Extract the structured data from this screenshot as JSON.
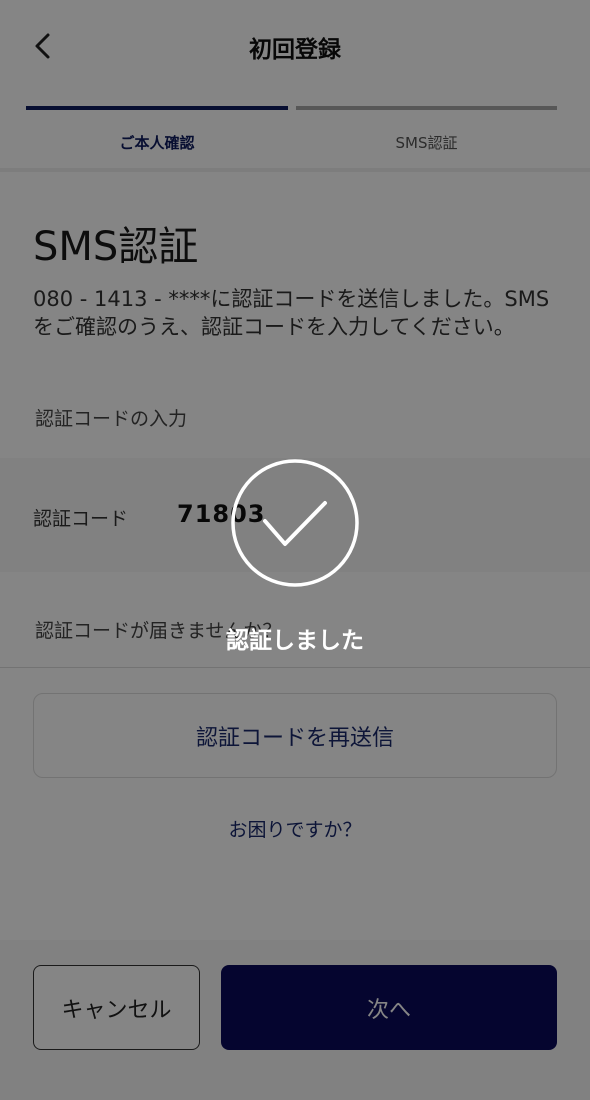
{
  "header": {
    "title": "初回登録"
  },
  "steps": [
    {
      "label": "ご本人確認",
      "state": "active"
    },
    {
      "label": "SMS認証",
      "state": "inactive"
    }
  ],
  "main": {
    "title": "SMS認証",
    "description": "080 - 1413 - ****に認証コードを送信しました。SMSをご確認のうえ、認証コードを入力してください。",
    "code_section_label": "認証コードの入力",
    "code_label": "認証コード",
    "code_value": "71803",
    "help_label": "認証コードが届きませんか？",
    "resend_button": "認証コードを再送信",
    "trouble_link": "お困りですか？"
  },
  "footer": {
    "cancel_button": "キャンセル",
    "next_button": "次へ"
  },
  "overlay": {
    "message": "認証しました",
    "icon": "check-icon"
  },
  "colors": {
    "accent": "#0e1b5e",
    "primary_button": "#0a0a5a",
    "overlay": "rgba(0,0,0,0.48)"
  }
}
